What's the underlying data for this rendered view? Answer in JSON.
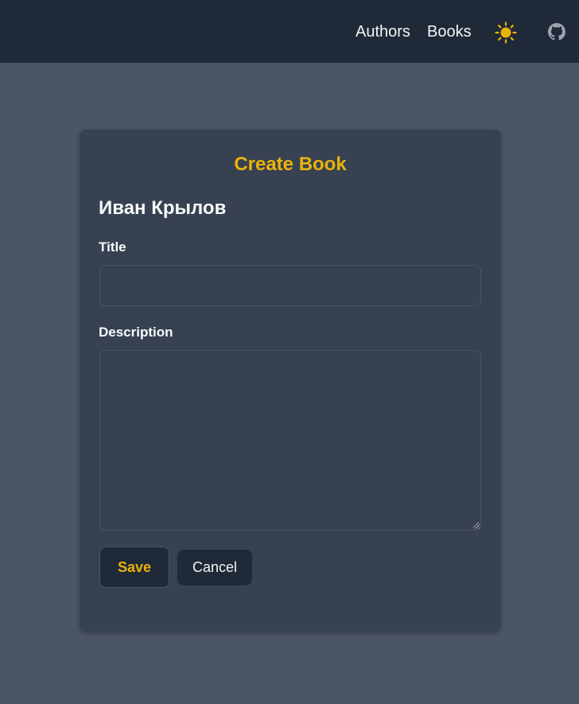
{
  "nav": {
    "authors_label": "Authors",
    "books_label": "Books",
    "theme_icon": "sun-icon",
    "github_icon": "github-icon"
  },
  "form": {
    "title": "Create Book",
    "author_name": "Иван Крылов",
    "title_label": "Title",
    "title_value": "",
    "description_label": "Description",
    "description_value": "",
    "save_label": "Save",
    "cancel_label": "Cancel"
  },
  "colors": {
    "navbar_bg": "#1f2937",
    "page_bg": "#4b5563",
    "card_bg": "#374151",
    "accent": "#eab308",
    "text": "#f9fafb"
  }
}
